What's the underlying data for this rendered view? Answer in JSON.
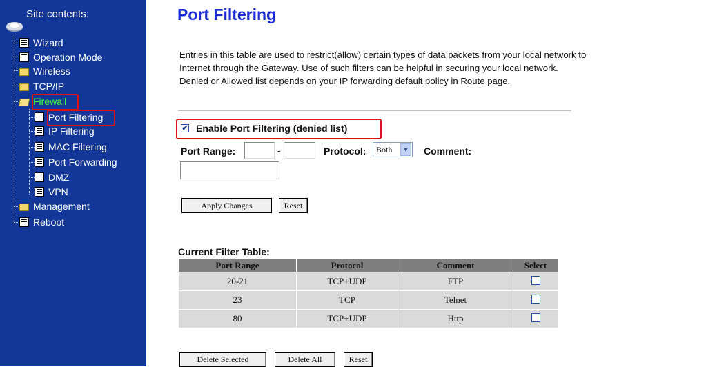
{
  "sidebar": {
    "title": "Site contents:",
    "items": [
      {
        "label": "Wizard",
        "icon": "page-icon"
      },
      {
        "label": "Operation Mode",
        "icon": "page-icon"
      },
      {
        "label": "Wireless",
        "icon": "folder-icon"
      },
      {
        "label": "TCP/IP",
        "icon": "folder-icon"
      },
      {
        "label": "Firewall",
        "icon": "open-folder-icon"
      },
      {
        "label": "Port Filtering",
        "icon": "page-icon"
      },
      {
        "label": "IP Filtering",
        "icon": "page-icon"
      },
      {
        "label": "MAC Filtering",
        "icon": "page-icon"
      },
      {
        "label": "Port Forwarding",
        "icon": "page-icon"
      },
      {
        "label": "DMZ",
        "icon": "page-icon"
      },
      {
        "label": "VPN",
        "icon": "page-icon"
      },
      {
        "label": "Management",
        "icon": "folder-icon"
      },
      {
        "label": "Reboot",
        "icon": "page-icon"
      }
    ],
    "background": "#123798",
    "active_color": "#3dff3d",
    "highlight_color": "#e01010"
  },
  "main": {
    "title": "Port Filtering",
    "title_color": "#1c2cd8",
    "intro": "Entries in this table are used to restrict(allow) certain types of data packets from your local network to Internet through the Gateway. Use of such filters can be helpful in securing your local network. Denied or Allowed list depends on your IP forwarding default policy in Route page.",
    "enable_label": "Enable Port Filtering (denied list)",
    "enable_checked": true,
    "port_range_label": "Port Range:",
    "range_separator": "-",
    "protocol_label": "Protocol:",
    "protocol_value": "Both",
    "comment_label": "Comment:",
    "apply_button": "Apply Changes",
    "reset_button": "Reset"
  },
  "filter_table": {
    "title": "Current Filter Table:",
    "headers": [
      "Port Range",
      "Protocol",
      "Comment",
      "Select"
    ],
    "rows": [
      {
        "port_range": "20-21",
        "protocol": "TCP+UDP",
        "comment": "FTP",
        "selected": false
      },
      {
        "port_range": "23",
        "protocol": "TCP",
        "comment": "Telnet",
        "selected": false
      },
      {
        "port_range": "80",
        "protocol": "TCP+UDP",
        "comment": "Http",
        "selected": false
      }
    ],
    "delete_selected_button": "Delete Selected",
    "delete_all_button": "Delete All",
    "reset_button": "Reset"
  }
}
